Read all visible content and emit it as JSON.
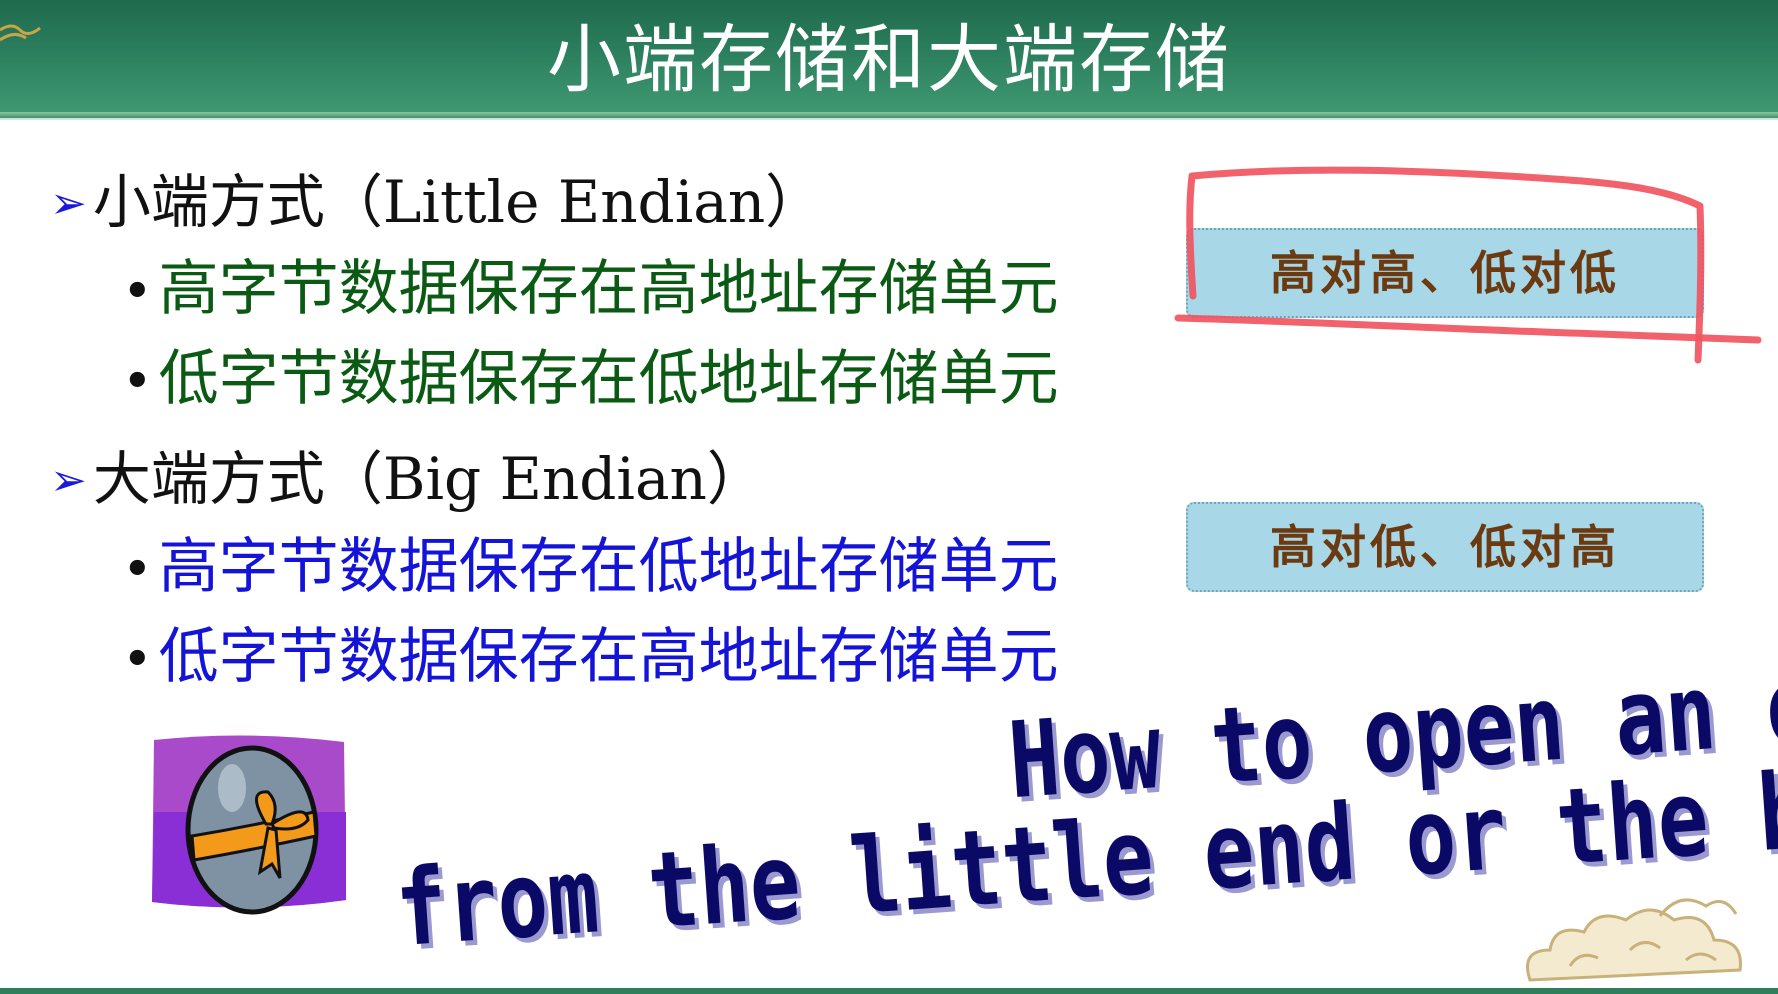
{
  "slide": {
    "title": "小端存储和大端存储",
    "little_endian": {
      "heading": "小端方式（Little Endian）",
      "items": [
        "高字节数据保存在高地址存储单元",
        "低字节数据保存在低地址存储单元"
      ],
      "callout": "高对高、低对低"
    },
    "big_endian": {
      "heading": "大端方式（Big Endian）",
      "items": [
        "高字节数据保存在低地址存储单元",
        "低字节数据保存在高地址存储单元"
      ],
      "callout": "高对低、低对高"
    },
    "egg_question": {
      "line1": "How to open an egg,",
      "line2": "from the little end or the big end ?"
    }
  },
  "colors": {
    "header_green": "#2b7e5d",
    "bullet_green": "#0b5a13",
    "bullet_blue": "#1414d8",
    "callout_bg": "#a8d8e8",
    "annotation_red": "#f0555f"
  },
  "icons": [
    "arrow-bullet-icon",
    "egg-gift-icon",
    "cloud-ornament-icon"
  ]
}
